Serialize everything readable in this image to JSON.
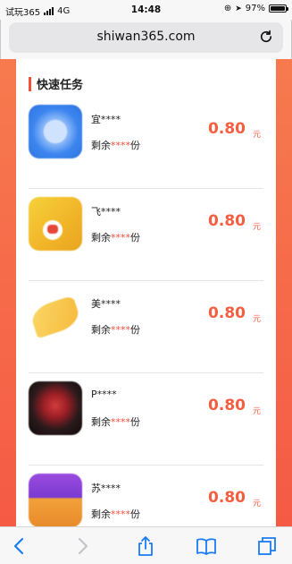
{
  "status_bar": {
    "carrier": "试玩365",
    "network": "4G",
    "time": "14:48",
    "battery": "97%",
    "battery_level": 0.97
  },
  "browser": {
    "url": "shiwan365.com"
  },
  "section": {
    "title": "快速任务"
  },
  "tasks": [
    {
      "name": "宜****",
      "remain_prefix": "剩余",
      "remain_stars": "****",
      "remain_suffix": "份",
      "price": "0.80",
      "unit": "元",
      "icon_color": "#3c86f0"
    },
    {
      "name": "飞****",
      "remain_prefix": "剩余",
      "remain_stars": "****",
      "remain_suffix": "份",
      "price": "0.80",
      "unit": "元",
      "icon_color": "#f2c233"
    },
    {
      "name": "美****",
      "remain_prefix": "剩余",
      "remain_stars": "****",
      "remain_suffix": "份",
      "price": "0.80",
      "unit": "元",
      "icon_color": "#f7c64a"
    },
    {
      "name": "P****",
      "remain_prefix": "剩余",
      "remain_stars": "****",
      "remain_suffix": "份",
      "price": "0.80",
      "unit": "元",
      "icon_color": "#2a1a1c"
    },
    {
      "name": "苏****",
      "remain_prefix": "剩余",
      "remain_stars": "****",
      "remain_suffix": "份",
      "price": "0.80",
      "unit": "元",
      "icon_color": "#8a3fd6"
    }
  ],
  "colors": {
    "accent": "#f45e41",
    "background_orange": "#f46a4c",
    "ios_blue": "#1a7cf5"
  },
  "toolbar": {
    "icons": [
      "back-icon",
      "forward-icon",
      "share-icon",
      "bookmarks-icon",
      "tabs-icon"
    ]
  }
}
